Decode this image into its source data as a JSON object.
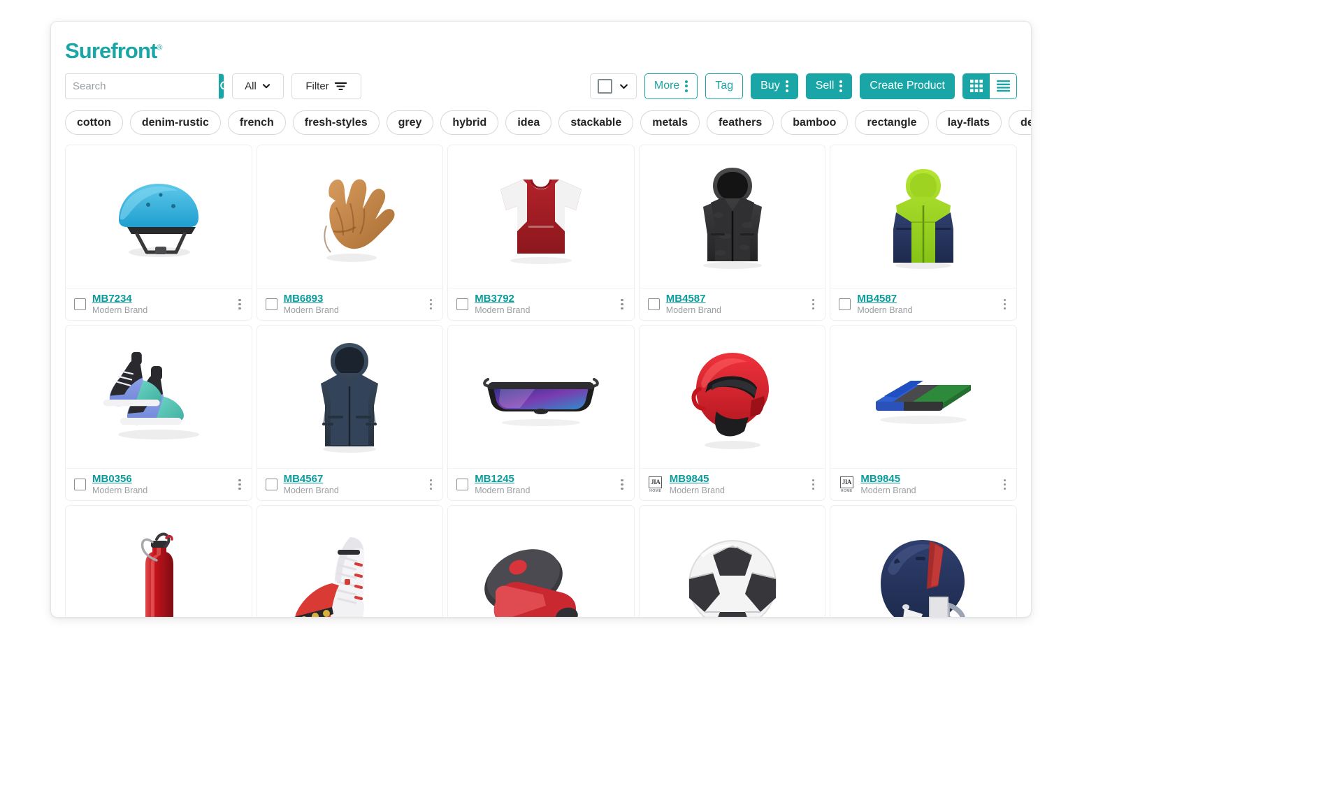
{
  "app": {
    "brand_name": "Surefront",
    "brand_mark": "®",
    "brand_color": "#1aa6a6"
  },
  "search": {
    "placeholder": "Search",
    "value": "",
    "icon": "search-icon"
  },
  "toolbar": {
    "scope_label": "All",
    "scope_icon": "chevron-down-icon",
    "filter_label": "Filter",
    "filter_icon": "filter-lines-icon",
    "select_all_icon": "checkbox-icon",
    "select_all_caret": "chevron-down-icon",
    "more_label": "More",
    "tag_label": "Tag",
    "buy_label": "Buy",
    "sell_label": "Sell",
    "create_product_label": "Create Product",
    "grid_view_icon": "grid-view-icon",
    "list_view_icon": "list-view-icon",
    "active_view": "grid"
  },
  "tags": [
    "cotton",
    "denim-rustic",
    "french",
    "fresh-styles",
    "grey",
    "hybrid",
    "idea",
    "stackable",
    "metals",
    "feathers",
    "bamboo",
    "rectangle",
    "lay-flats",
    "detached"
  ],
  "products": [
    {
      "sku": "MB7234",
      "brand": "Modern Brand",
      "badge": "checkbox",
      "image": "blue-bike-helmet",
      "menu_icon": "kebab-menu-icon"
    },
    {
      "sku": "MB6893",
      "brand": "Modern Brand",
      "badge": "checkbox",
      "image": "baseball-glove",
      "menu_icon": "kebab-menu-icon"
    },
    {
      "sku": "MB3792",
      "brand": "Modern Brand",
      "badge": "checkbox",
      "image": "red-white-jersey",
      "menu_icon": "kebab-menu-icon"
    },
    {
      "sku": "MB4587",
      "brand": "Modern Brand",
      "badge": "checkbox",
      "image": "black-hooded-jacket",
      "menu_icon": "kebab-menu-icon"
    },
    {
      "sku": "MB4587",
      "brand": "Modern Brand",
      "badge": "checkbox",
      "image": "green-navy-jacket",
      "menu_icon": "kebab-menu-icon"
    },
    {
      "sku": "MB0356",
      "brand": "Modern Brand",
      "badge": "checkbox",
      "image": "teal-sneakers",
      "menu_icon": "kebab-menu-icon"
    },
    {
      "sku": "MB4567",
      "brand": "Modern Brand",
      "badge": "checkbox",
      "image": "navy-raincoat",
      "menu_icon": "kebab-menu-icon"
    },
    {
      "sku": "MB1245",
      "brand": "Modern Brand",
      "badge": "checkbox",
      "image": "sport-sunglasses",
      "menu_icon": "kebab-menu-icon"
    },
    {
      "sku": "MB9845",
      "brand": "Modern Brand",
      "badge": "jia-home-logo",
      "image": "red-motocross-helmet",
      "menu_icon": "kebab-menu-icon"
    },
    {
      "sku": "MB9845",
      "brand": "Modern Brand",
      "badge": "jia-home-logo",
      "image": "blue-green-towel",
      "menu_icon": "kebab-menu-icon"
    }
  ],
  "partial_row": [
    {
      "image": "red-water-bottle"
    },
    {
      "image": "white-red-track-spike"
    },
    {
      "image": "red-boxing-pads"
    },
    {
      "image": "black-white-soccer-ball"
    },
    {
      "image": "navy-football-helmet"
    }
  ],
  "jia_badge": {
    "mark": "JIA",
    "sub": "HOME"
  }
}
